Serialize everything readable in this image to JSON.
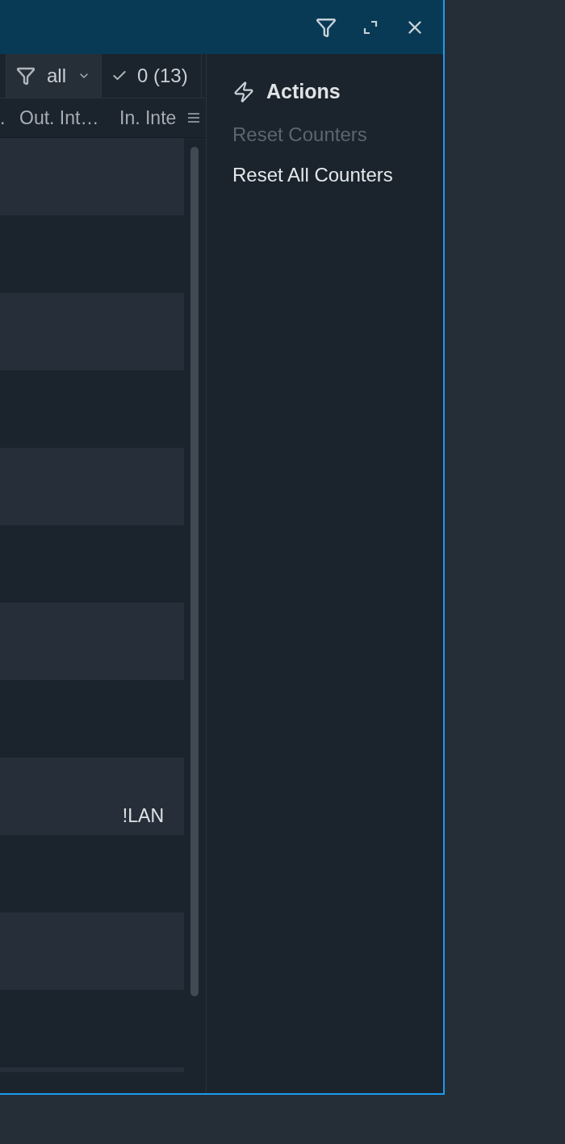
{
  "table": {
    "toolbar": {
      "filter": {
        "label": "all"
      },
      "count": {
        "label": "0 (13)"
      }
    },
    "columns": [
      ".",
      "Out. Int…",
      "In. Inte"
    ],
    "rows": [
      {},
      {},
      {},
      {},
      {},
      {},
      {},
      {},
      {
        "in_interface": "!LAN"
      },
      {},
      {},
      {},
      {}
    ]
  },
  "actions_panel": {
    "title": "Actions",
    "items": [
      {
        "label": "Reset Counters",
        "disabled": true
      },
      {
        "label": "Reset All Counters",
        "disabled": false
      }
    ]
  }
}
